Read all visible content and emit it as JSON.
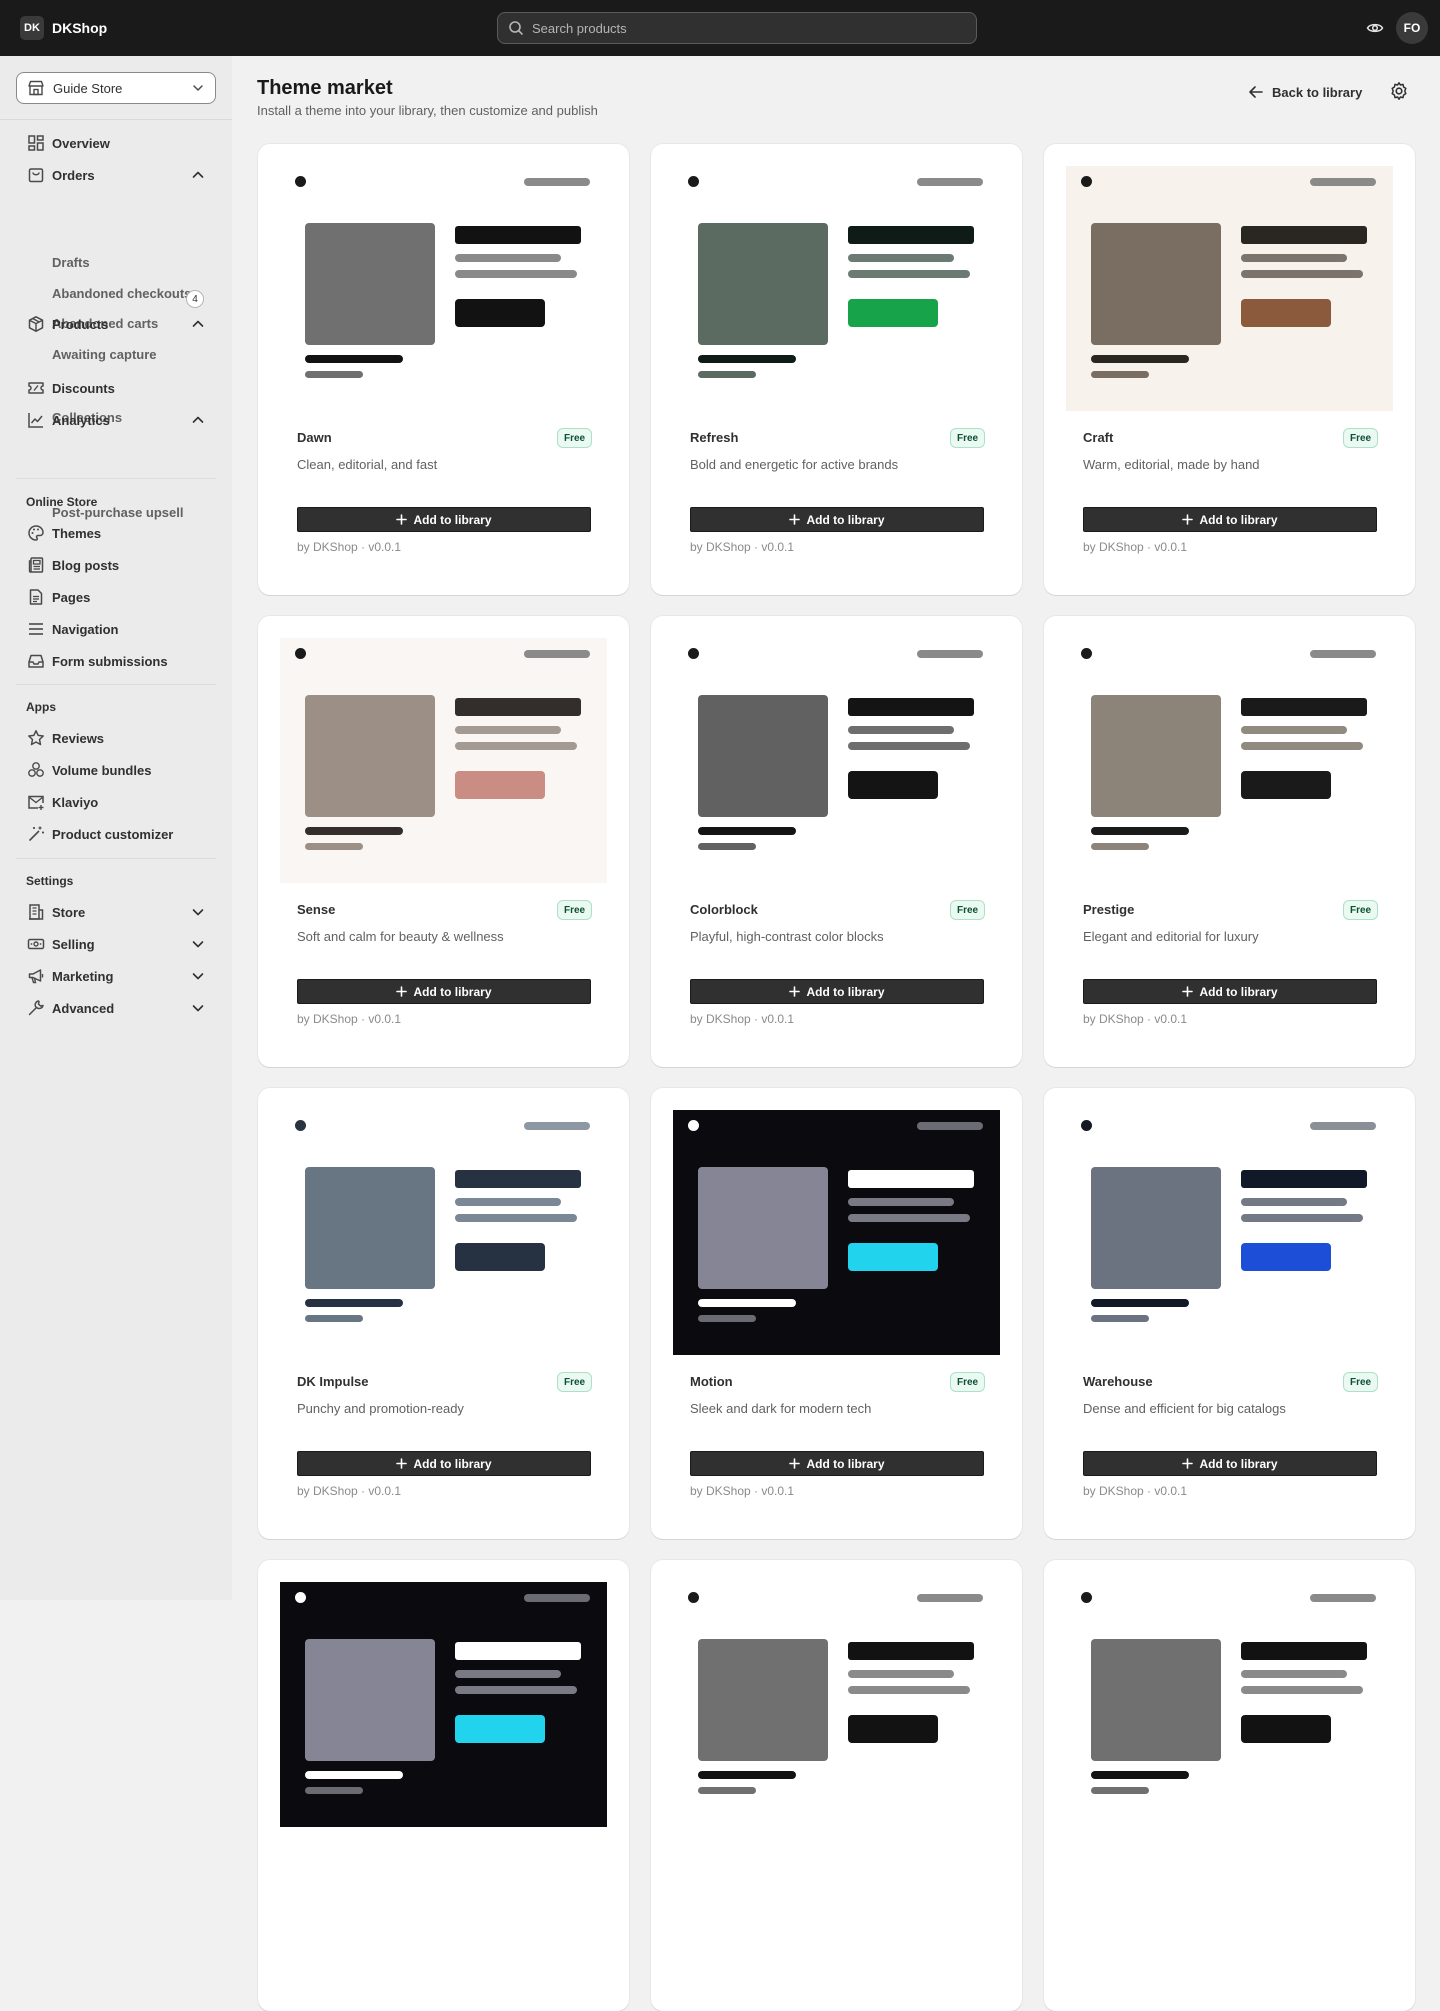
{
  "app": {
    "logo_text": "DK",
    "name": "DKShop",
    "user_initials": "FO"
  },
  "search": {
    "placeholder": "Search products"
  },
  "sidebar": {
    "store": "Guide Store",
    "nav": [
      {
        "label": "Overview",
        "icon": "dashboard-icon"
      },
      {
        "label": "Orders",
        "icon": "orders-icon",
        "expanded": true
      },
      {
        "label": "Products",
        "icon": "product-icon",
        "expanded": true
      },
      {
        "label": "Discounts",
        "icon": "discount-icon"
      },
      {
        "label": "Analytics",
        "icon": "analytics-icon",
        "expanded": true
      }
    ],
    "orders_sub": [
      "Drafts",
      "Abandoned checkouts",
      "Abandoned carts",
      "Awaiting capture"
    ],
    "awaiting_count": "4",
    "products_sub": [
      "Collections"
    ],
    "analytics_sub": [
      "Post-purchase upsell"
    ],
    "online_store_title": "Online Store",
    "online_store": [
      {
        "label": "Themes",
        "icon": "palette-icon"
      },
      {
        "label": "Blog posts",
        "icon": "blog-icon"
      },
      {
        "label": "Pages",
        "icon": "page-icon"
      },
      {
        "label": "Navigation",
        "icon": "menu-icon"
      },
      {
        "label": "Form submissions",
        "icon": "inbox-icon"
      }
    ],
    "apps_title": "Apps",
    "apps": [
      {
        "label": "Reviews",
        "icon": "star-icon"
      },
      {
        "label": "Volume bundles",
        "icon": "bundle-icon"
      },
      {
        "label": "Klaviyo",
        "icon": "mail-icon"
      },
      {
        "label": "Product customizer",
        "icon": "magic-wand-icon"
      }
    ],
    "settings_title": "Settings",
    "settings": [
      {
        "label": "Store",
        "icon": "building-icon"
      },
      {
        "label": "Selling",
        "icon": "cash-icon"
      },
      {
        "label": "Marketing",
        "icon": "megaphone-icon"
      },
      {
        "label": "Advanced",
        "icon": "wrench-icon"
      }
    ]
  },
  "header": {
    "title": "Theme market",
    "subtitle": "Install a theme into your library, then customize and publish",
    "back_label": "Back to library"
  },
  "themes": [
    {
      "name": "Dawn",
      "desc": "Clean, editorial, and fast",
      "badge": "Free",
      "button": "Add to library",
      "meta": "by DKShop · v0.0.1",
      "colors": {
        "bg": "#ffffff",
        "dot": "#1a1a1a",
        "pill": "#8a8a8a",
        "img": "#707070",
        "heading": "#121212",
        "line": "#8a8a8a",
        "btn": "#121212",
        "cap1": "#121212",
        "cap2": "#707070"
      }
    },
    {
      "name": "Refresh",
      "desc": "Bold and energetic for active brands",
      "badge": "Free",
      "button": "Add to library",
      "meta": "by DKShop · v0.0.1",
      "colors": {
        "bg": "#ffffff",
        "dot": "#1a1a1a",
        "pill": "#8a8a8a",
        "img": "#5b6b62",
        "heading": "#0e1b16",
        "line": "#6b7a72",
        "btn": "#16a34a",
        "cap1": "#0e1b16",
        "cap2": "#5b6b62"
      }
    },
    {
      "name": "Craft",
      "desc": "Warm, editorial, made by hand",
      "badge": "Free",
      "button": "Add to library",
      "meta": "by DKShop · v0.0.1",
      "colors": {
        "bg": "#f7f3ec",
        "dot": "#1a1a1a",
        "pill": "#8a8a8a",
        "img": "#7a6e62",
        "heading": "#2a2622",
        "line": "#7a746d",
        "btn": "#8b5a3c",
        "cap1": "#2a2622",
        "cap2": "#7a6e62"
      }
    },
    {
      "name": "Sense",
      "desc": "Soft and calm for beauty & wellness",
      "badge": "Free",
      "button": "Add to library",
      "meta": "by DKShop · v0.0.1",
      "colors": {
        "bg": "#faf6f3",
        "dot": "#1a1a1a",
        "pill": "#8a8a8a",
        "img": "#9b8f86",
        "heading": "#332e2b",
        "line": "#a39a94",
        "btn": "#c98d84",
        "cap1": "#332e2b",
        "cap2": "#9b8f86"
      }
    },
    {
      "name": "Colorblock",
      "desc": "Playful, high-contrast color blocks",
      "badge": "Free",
      "button": "Add to library",
      "meta": "by DKShop · v0.0.1",
      "colors": {
        "bg": "#ffffff",
        "dot": "#1a1a1a",
        "pill": "#8a8a8a",
        "img": "#616161",
        "heading": "#141414",
        "line": "#6e6e6e",
        "btn": "#141414",
        "cap1": "#141414",
        "cap2": "#616161"
      }
    },
    {
      "name": "Prestige",
      "desc": "Elegant and editorial for luxury",
      "badge": "Free",
      "button": "Add to library",
      "meta": "by DKShop · v0.0.1",
      "colors": {
        "bg": "#ffffff",
        "dot": "#1a1a1a",
        "pill": "#8a8a8a",
        "img": "#8c8478",
        "heading": "#1a1a1a",
        "line": "#918a80",
        "btn": "#1a1a1a",
        "cap1": "#1a1a1a",
        "cap2": "#8c8478"
      }
    },
    {
      "name": "DK Impulse",
      "desc": "Punchy and promotion-ready",
      "badge": "Free",
      "button": "Add to library",
      "meta": "by DKShop · v0.0.1",
      "colors": {
        "bg": "#ffffff",
        "dot": "#2a3340",
        "pill": "#8e98a4",
        "img": "#687684",
        "heading": "#263241",
        "line": "#7a8795",
        "btn": "#263241",
        "cap1": "#263241",
        "cap2": "#687684"
      }
    },
    {
      "name": "Motion",
      "desc": "Sleek and dark for modern tech",
      "badge": "Free",
      "button": "Add to library",
      "meta": "by DKShop · v0.0.1",
      "colors": {
        "bg": "#0a0a0f",
        "dot": "#ffffff",
        "pill": "#6b6b73",
        "img": "#868595",
        "heading": "#ffffff",
        "line": "#7a7a84",
        "btn": "#22d3ee",
        "cap1": "#ffffff",
        "cap2": "#6b6b73"
      }
    },
    {
      "name": "Warehouse",
      "desc": "Dense and efficient for big catalogs",
      "badge": "Free",
      "button": "Add to library",
      "meta": "by DKShop · v0.0.1",
      "colors": {
        "bg": "#ffffff",
        "dot": "#141a24",
        "pill": "#8a8f98",
        "img": "#6b7280",
        "heading": "#111827",
        "line": "#737985",
        "btn": "#1d4ed8",
        "cap1": "#111827",
        "cap2": "#6b7280"
      }
    },
    {
      "name": "",
      "desc": "",
      "badge": "",
      "button": "",
      "meta": "",
      "colors": {
        "bg": "#0a0a0f",
        "dot": "#ffffff",
        "pill": "#6b6b73",
        "img": "#868595",
        "heading": "#ffffff",
        "line": "#7a7a84",
        "btn": "#22d3ee",
        "cap1": "#ffffff",
        "cap2": "#6b6b73"
      }
    },
    {
      "name": "",
      "desc": "",
      "badge": "",
      "button": "",
      "meta": "",
      "colors": {
        "bg": "#ffffff",
        "dot": "#1a1a1a",
        "pill": "#8a8a8a",
        "img": "#707070",
        "heading": "#121212",
        "line": "#8a8a8a",
        "btn": "#121212",
        "cap1": "#121212",
        "cap2": "#707070"
      }
    },
    {
      "name": "",
      "desc": "",
      "badge": "",
      "button": "",
      "meta": "",
      "colors": {
        "bg": "#ffffff",
        "dot": "#1a1a1a",
        "pill": "#8a8a8a",
        "img": "#707070",
        "heading": "#121212",
        "line": "#8a8a8a",
        "btn": "#121212",
        "cap1": "#121212",
        "cap2": "#707070"
      }
    }
  ]
}
